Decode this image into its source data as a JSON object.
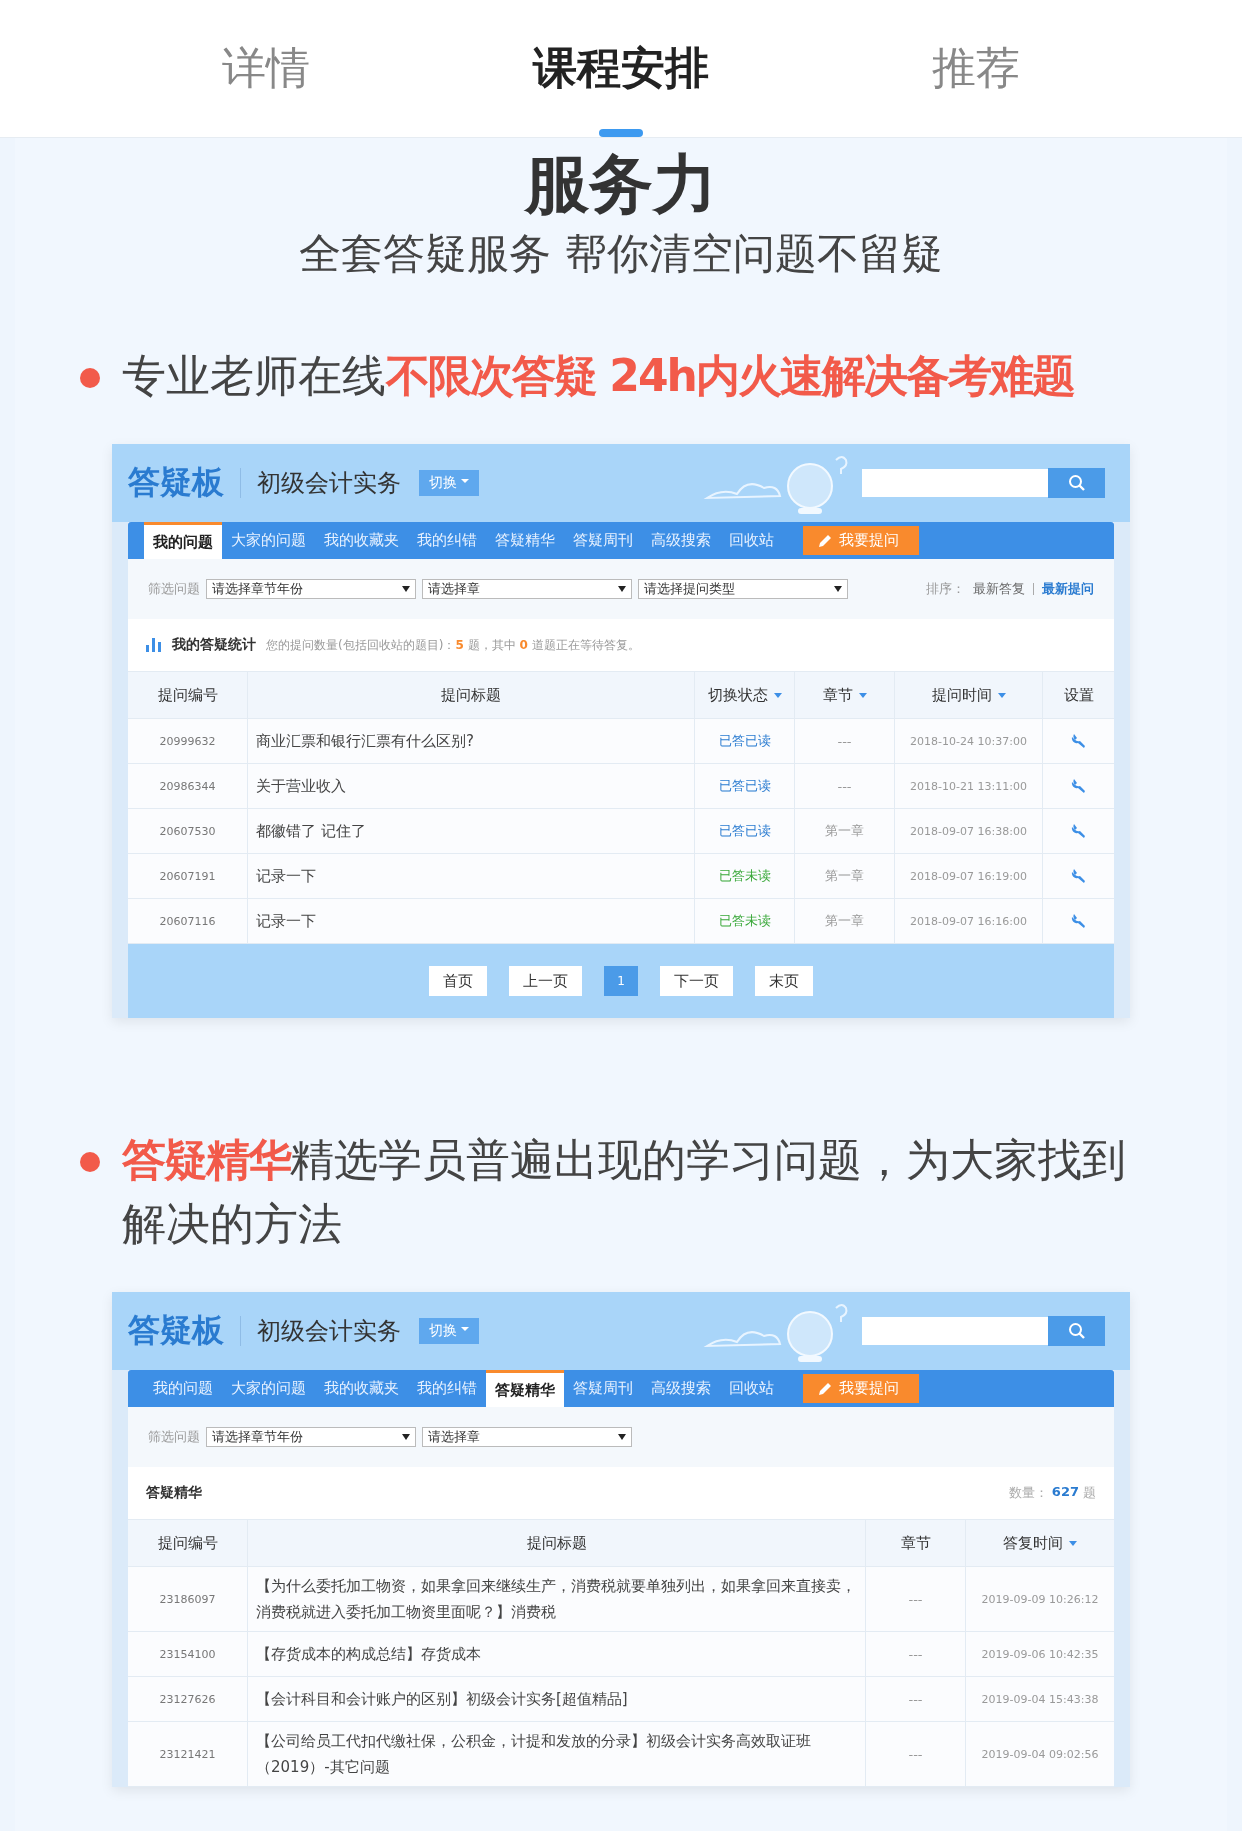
{
  "tabs": [
    {
      "label": "详情",
      "selected": false
    },
    {
      "label": "课程安排",
      "selected": true
    },
    {
      "label": "推荐",
      "selected": false
    }
  ],
  "hero": {
    "title": "服务力",
    "subtitle": "全套答疑服务 帮你清空问题不留疑"
  },
  "sections": [
    {
      "bullet": "专业老师在线**不限次答疑 24h内火速解决备考难题**",
      "board": {
        "logo": "答疑板",
        "course": "初级会计实务",
        "switch": "切换",
        "nav": [
          {
            "label": "我的问题",
            "selected": true
          },
          {
            "label": "大家的问题",
            "selected": false
          },
          {
            "label": "我的收藏夹",
            "selected": false
          },
          {
            "label": "我的纠错",
            "selected": false
          },
          {
            "label": "答疑精华",
            "selected": false
          },
          {
            "label": "答疑周刊",
            "selected": false
          },
          {
            "label": "高级搜索",
            "selected": false
          },
          {
            "label": "回收站",
            "selected": false
          }
        ],
        "ask": "我要提问",
        "filter_label": "筛选问题",
        "selects": [
          "请选择章节年份",
          "请选择章",
          "请选择提问类型"
        ],
        "sort": {
          "label": "排序：",
          "options": [
            {
              "label": "最新答复",
              "selected": false
            },
            {
              "label": "最新提问",
              "selected": true
            }
          ]
        },
        "summary": {
          "kind": "stats",
          "title": "我的答疑统计",
          "text": "您的提问数量(包括回收站的题目)：**5** 题，其中 **0** 道题正在等待答复。"
        },
        "table": {
          "columns": [
            {
              "label": "提问编号",
              "kind": "id",
              "sortable": false
            },
            {
              "label": "提问标题",
              "kind": "title",
              "sortable": false
            },
            {
              "label": "切换状态",
              "kind": "status",
              "sortable": true
            },
            {
              "label": "章节",
              "kind": "chapter",
              "sortable": true
            },
            {
              "label": "提问时间",
              "kind": "time",
              "sortable": true
            },
            {
              "label": "设置",
              "kind": "action",
              "sortable": false
            }
          ],
          "rows": [
            {
              "cells": [
                "20999632",
                "商业汇票和银行汇票有什么区别?",
                "已答已读",
                "---",
                "2018-10-24 10:37:00"
              ],
              "read": true
            },
            {
              "cells": [
                "20986344",
                "关于营业收入",
                "已答已读",
                "---",
                "2018-10-21 13:11:00"
              ],
              "read": true
            },
            {
              "cells": [
                "20607530",
                "都徽错了 记住了",
                "已答已读",
                "第一章",
                "2018-09-07 16:38:00"
              ],
              "read": true
            },
            {
              "cells": [
                "20607191",
                "记录一下",
                "已答未读",
                "第一章",
                "2018-09-07 16:19:00"
              ],
              "read": false
            },
            {
              "cells": [
                "20607116",
                "记录一下",
                "已答未读",
                "第一章",
                "2018-09-07 16:16:00"
              ],
              "read": false
            }
          ]
        },
        "pagination": [
          {
            "label": "首页",
            "selected": false
          },
          {
            "label": "上一页",
            "selected": false
          },
          {
            "label": "1",
            "selected": true
          },
          {
            "label": "下一页",
            "selected": false
          },
          {
            "label": "末页",
            "selected": false
          }
        ]
      }
    },
    {
      "bullet": "**答疑精华**精选学员普遍出现的学习问题，为大家找到解决的方法",
      "board": {
        "logo": "答疑板",
        "course": "初级会计实务",
        "switch": "切换",
        "nav": [
          {
            "label": "我的问题",
            "selected": false
          },
          {
            "label": "大家的问题",
            "selected": false
          },
          {
            "label": "我的收藏夹",
            "selected": false
          },
          {
            "label": "我的纠错",
            "selected": false
          },
          {
            "label": "答疑精华",
            "selected": true
          },
          {
            "label": "答疑周刊",
            "selected": false
          },
          {
            "label": "高级搜索",
            "selected": false
          },
          {
            "label": "回收站",
            "selected": false
          }
        ],
        "ask": "我要提问",
        "filter_label": "筛选问题",
        "selects": [
          "请选择章节年份",
          "请选择章"
        ],
        "summary": {
          "kind": "count",
          "title": "答疑精华",
          "count_label": "数量：",
          "count": "627",
          "unit": "题"
        },
        "table": {
          "columns": [
            {
              "label": "提问编号",
              "kind": "id",
              "sortable": false
            },
            {
              "label": "提问标题",
              "kind": "title",
              "sortable": false
            },
            {
              "label": "章节",
              "kind": "chapter",
              "sortable": false
            },
            {
              "label": "答复时间",
              "kind": "time",
              "sortable": true
            }
          ],
          "rows": [
            {
              "cells": [
                "23186097",
                "【为什么委托加工物资，如果拿回来继续生产，消费税就要单独列出，如果拿回来直接卖，消费税就进入委托加工物资里面呢？】消费税",
                "---",
                "2019-09-09 10:26:12"
              ]
            },
            {
              "cells": [
                "23154100",
                "【存货成本的构成总结】存货成本",
                "---",
                "2019-09-06 10:42:35"
              ]
            },
            {
              "cells": [
                "23127626",
                "【会计科目和会计账户的区别】初级会计实务[超值精品]",
                "---",
                "2019-09-04 15:43:38"
              ]
            },
            {
              "cells": [
                "23121421",
                "【公司给员工代扣代缴社保，公积金，计提和发放的分录】初级会计实务高效取证班（2019）-其它问题",
                "---",
                "2019-09-04 09:02:56"
              ]
            }
          ]
        }
      }
    }
  ]
}
